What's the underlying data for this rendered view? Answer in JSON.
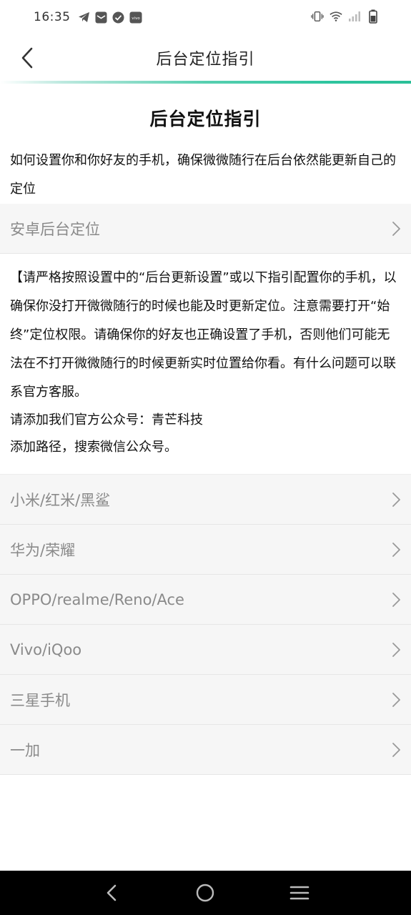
{
  "status_bar": {
    "time": "16:35",
    "left_icons": [
      "telegram-icon",
      "mail-icon",
      "check-circle-icon",
      "vivo-icon"
    ],
    "right_icons": [
      "vibrate-icon",
      "wifi-icon",
      "signal-icon",
      "battery-icon"
    ]
  },
  "header": {
    "title": "后台定位指引"
  },
  "page": {
    "heading": "后台定位指引",
    "intro": "如何设置你和你好友的手机，确保微微随行在后台依然能更新自己的定位",
    "android_row": "安卓后台定位",
    "notice": {
      "paragraph": "【请严格按照设置中的“后台更新设置”或以下指引配置你的手机，以确保你没打开微微随行的时候也能及时更新定位。注意需要打开“始终”定位权限。请确保你的好友也正确设置了手机，否则他们可能无法在不打开微微随行的时候更新实时位置给你看。有什么问题可以联系官方客服。",
      "account_line": "请添加我们官方公众号：青芒科技",
      "path_line": "添加路径，搜索微信公众号。"
    },
    "brands": [
      {
        "label": "小米/红米/黑鲨"
      },
      {
        "label": "华为/荣耀"
      },
      {
        "label": "OPPO/realme/Reno/Ace"
      },
      {
        "label": "Vivo/iQoo"
      },
      {
        "label": "三星手机"
      },
      {
        "label": "一加"
      }
    ]
  },
  "nav_bar": {
    "buttons": [
      "back-icon",
      "home-icon",
      "menu-icon"
    ]
  },
  "colors": {
    "accent": "#2bbf98",
    "row_bg": "#f6f6f6",
    "row_text": "#8a8a8a",
    "nav_bg": "#000000"
  }
}
